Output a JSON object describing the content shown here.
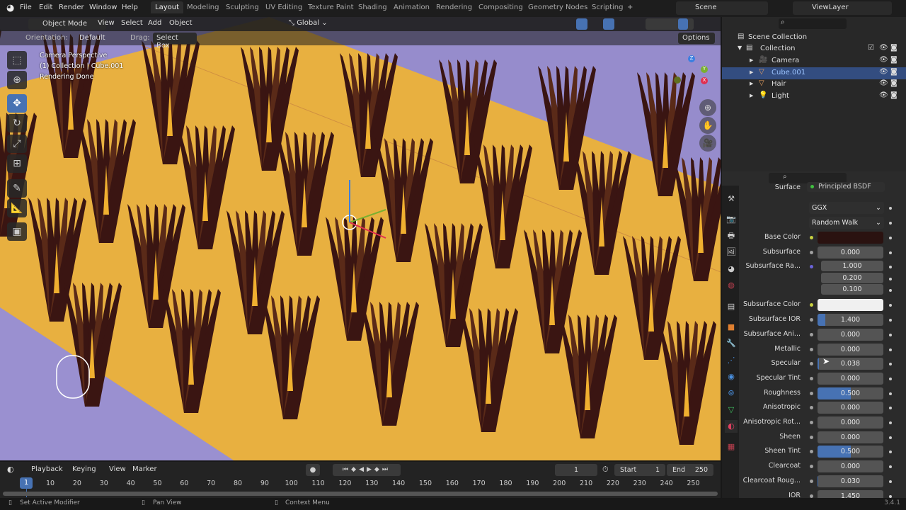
{
  "menu": [
    "File",
    "Edit",
    "Render",
    "Window",
    "Help"
  ],
  "workspaces": [
    "Layout",
    "Modeling",
    "Sculpting",
    "UV Editing",
    "Texture Paint",
    "Shading",
    "Animation",
    "Rendering",
    "Compositing",
    "Geometry Nodes",
    "Scripting",
    "+"
  ],
  "scene": "Scene",
  "view_layer": "ViewLayer",
  "vp_header": {
    "mode": "Object Mode",
    "menus": [
      "View",
      "Select",
      "Add",
      "Object"
    ],
    "transform": "Global",
    "orientation_label": "Orientation:",
    "orientation": "Default",
    "drag_label": "Drag:",
    "drag": "Select Box",
    "options": "Options"
  },
  "vp_overlay": {
    "line1": "Camera Perspective",
    "line2": "(1) Collection | Cube.001",
    "line3": "Rendering Done"
  },
  "gizmo": {
    "z": "Z",
    "y": "Y",
    "x": "X"
  },
  "outliner": {
    "root": "Scene Collection",
    "collection": "Collection",
    "items": [
      {
        "name": "Camera",
        "icon": "camera-icon",
        "color": "#e8a060"
      },
      {
        "name": "Cube.001",
        "icon": "mesh-icon",
        "color": "#e8a060",
        "selected": true
      },
      {
        "name": "Hair",
        "icon": "curves-icon",
        "color": "#e8a060"
      },
      {
        "name": "Light",
        "icon": "light-icon",
        "color": "#e8a060"
      }
    ]
  },
  "props": {
    "surface_label": "Surface",
    "surface_value": "Principled BSDF",
    "distribution": "GGX",
    "subsurface_method": "Random Walk",
    "rows": [
      {
        "label": "Base Color",
        "socket": "#c8d040",
        "color": "#2a1210"
      },
      {
        "label": "Subsurface",
        "socket": "#a0a0a0",
        "value": "0.000",
        "fill": 0
      },
      {
        "label": "Subsurface Ra...",
        "socket": "#6b63d8",
        "value": "1.000",
        "fill": 0,
        "sub": true
      },
      {
        "label": "",
        "value": "0.200",
        "fill": 0,
        "sub": true,
        "cont": true
      },
      {
        "label": "",
        "value": "0.100",
        "fill": 0,
        "sub": true,
        "cont": true
      },
      {
        "label": "Subsurface Color",
        "socket": "#c8d040",
        "color": "#f0f0f0"
      },
      {
        "label": "Subsurface IOR",
        "socket": "#a0a0a0",
        "value": "1.400",
        "fill": 0.12
      },
      {
        "label": "Subsurface Ani...",
        "socket": "#a0a0a0",
        "value": "0.000",
        "fill": 0
      },
      {
        "label": "Metallic",
        "socket": "#a0a0a0",
        "value": "0.000",
        "fill": 0
      },
      {
        "label": "Specular",
        "socket": "#a0a0a0",
        "value": "0.038",
        "fill": 0.02
      },
      {
        "label": "Specular Tint",
        "socket": "#a0a0a0",
        "value": "0.000",
        "fill": 0
      },
      {
        "label": "Roughness",
        "socket": "#a0a0a0",
        "value": "0.500",
        "fill": 0.5
      },
      {
        "label": "Anisotropic",
        "socket": "#a0a0a0",
        "value": "0.000",
        "fill": 0
      },
      {
        "label": "Anisotropic Rot...",
        "socket": "#a0a0a0",
        "value": "0.000",
        "fill": 0
      },
      {
        "label": "Sheen",
        "socket": "#a0a0a0",
        "value": "0.000",
        "fill": 0
      },
      {
        "label": "Sheen Tint",
        "socket": "#a0a0a0",
        "value": "0.500",
        "fill": 0.5
      },
      {
        "label": "Clearcoat",
        "socket": "#a0a0a0",
        "value": "0.000",
        "fill": 0
      },
      {
        "label": "Clearcoat Roug...",
        "socket": "#a0a0a0",
        "value": "0.030",
        "fill": 0.01
      },
      {
        "label": "IOR",
        "socket": "#a0a0a0",
        "value": "1.450",
        "fill": 0
      }
    ]
  },
  "timeline": {
    "menus": [
      "Playback",
      "Keying",
      "View",
      "Marker"
    ],
    "current_frame": "1",
    "start_label": "Start",
    "start": "1",
    "end_label": "End",
    "end": "250",
    "ticks": [
      "10",
      "20",
      "30",
      "40",
      "50",
      "60",
      "70",
      "80",
      "90",
      "100",
      "110",
      "120",
      "130",
      "140",
      "150",
      "160",
      "170",
      "180",
      "190",
      "200",
      "210",
      "220",
      "230",
      "240",
      "250"
    ]
  },
  "status": {
    "left": "Set Active Modifier",
    "middle": "Pan View",
    "right": "Context Menu",
    "version": "3.4.1"
  },
  "colors": {
    "accent": "#4772b3",
    "floor": "#e8b040",
    "background": "#968ccc",
    "hair": "#3a1512"
  }
}
